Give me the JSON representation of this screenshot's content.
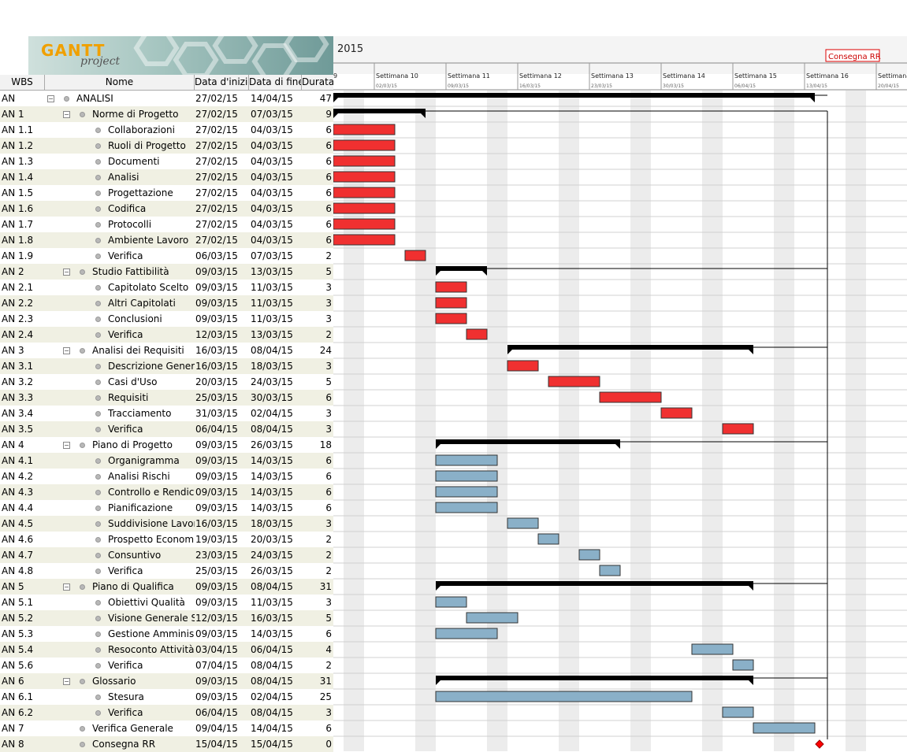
{
  "app": {
    "logo_main": "GANTT",
    "logo_sub": "project"
  },
  "columns": {
    "wbs": "WBS",
    "name": "Nome",
    "start": "Data d'inizio",
    "end": "Data di fine",
    "dur": "Durata"
  },
  "timeline": {
    "year": "2015",
    "milestone_label": "Consegna RR",
    "left_tick": "9",
    "weeks": [
      {
        "label": "Settimana 10",
        "date": "02/03/15"
      },
      {
        "label": "Settimana 11",
        "date": "09/03/15"
      },
      {
        "label": "Settimana 12",
        "date": "16/03/15"
      },
      {
        "label": "Settimana 13",
        "date": "23/03/15"
      },
      {
        "label": "Settimana 14",
        "date": "30/03/15"
      },
      {
        "label": "Settimana 15",
        "date": "06/04/15"
      },
      {
        "label": "Settimana 16",
        "date": "13/04/15"
      },
      {
        "label": "Settimana",
        "date": "20/04/15"
      }
    ]
  },
  "tasks": [
    {
      "wbs": "AN",
      "name": "ANALISI",
      "start": "27/02/15",
      "end": "14/04/15",
      "dur": "47",
      "level": 0,
      "group": true,
      "color": "#000000"
    },
    {
      "wbs": "AN 1",
      "name": "Norme di Progetto",
      "start": "27/02/15",
      "end": "07/03/15",
      "dur": "9",
      "level": 1,
      "group": true,
      "color": "#000000"
    },
    {
      "wbs": "AN 1.1",
      "name": "Collaborazioni",
      "start": "27/02/15",
      "end": "04/03/15",
      "dur": "6",
      "level": 2,
      "group": false,
      "color": "#f03030"
    },
    {
      "wbs": "AN 1.2",
      "name": "Ruoli di Progetto",
      "start": "27/02/15",
      "end": "04/03/15",
      "dur": "6",
      "level": 2,
      "group": false,
      "color": "#f03030"
    },
    {
      "wbs": "AN 1.3",
      "name": "Documenti",
      "start": "27/02/15",
      "end": "04/03/15",
      "dur": "6",
      "level": 2,
      "group": false,
      "color": "#f03030"
    },
    {
      "wbs": "AN 1.4",
      "name": "Analisi",
      "start": "27/02/15",
      "end": "04/03/15",
      "dur": "6",
      "level": 2,
      "group": false,
      "color": "#f03030"
    },
    {
      "wbs": "AN 1.5",
      "name": "Progettazione",
      "start": "27/02/15",
      "end": "04/03/15",
      "dur": "6",
      "level": 2,
      "group": false,
      "color": "#f03030"
    },
    {
      "wbs": "AN 1.6",
      "name": "Codifica",
      "start": "27/02/15",
      "end": "04/03/15",
      "dur": "6",
      "level": 2,
      "group": false,
      "color": "#f03030"
    },
    {
      "wbs": "AN 1.7",
      "name": "Protocolli",
      "start": "27/02/15",
      "end": "04/03/15",
      "dur": "6",
      "level": 2,
      "group": false,
      "color": "#f03030"
    },
    {
      "wbs": "AN 1.8",
      "name": "Ambiente Lavoro",
      "start": "27/02/15",
      "end": "04/03/15",
      "dur": "6",
      "level": 2,
      "group": false,
      "color": "#f03030"
    },
    {
      "wbs": "AN 1.9",
      "name": "Verifica",
      "start": "06/03/15",
      "end": "07/03/15",
      "dur": "2",
      "level": 2,
      "group": false,
      "color": "#f03030"
    },
    {
      "wbs": "AN 2",
      "name": "Studio Fattibilità",
      "start": "09/03/15",
      "end": "13/03/15",
      "dur": "5",
      "level": 1,
      "group": true,
      "color": "#000000"
    },
    {
      "wbs": "AN 2.1",
      "name": "Capitolato Scelto",
      "start": "09/03/15",
      "end": "11/03/15",
      "dur": "3",
      "level": 2,
      "group": false,
      "color": "#f03030"
    },
    {
      "wbs": "AN 2.2",
      "name": "Altri Capitolati",
      "start": "09/03/15",
      "end": "11/03/15",
      "dur": "3",
      "level": 2,
      "group": false,
      "color": "#f03030"
    },
    {
      "wbs": "AN 2.3",
      "name": "Conclusioni",
      "start": "09/03/15",
      "end": "11/03/15",
      "dur": "3",
      "level": 2,
      "group": false,
      "color": "#f03030"
    },
    {
      "wbs": "AN 2.4",
      "name": "Verifica",
      "start": "12/03/15",
      "end": "13/03/15",
      "dur": "2",
      "level": 2,
      "group": false,
      "color": "#f03030"
    },
    {
      "wbs": "AN 3",
      "name": "Analisi dei Requisiti",
      "start": "16/03/15",
      "end": "08/04/15",
      "dur": "24",
      "level": 1,
      "group": true,
      "color": "#000000"
    },
    {
      "wbs": "AN 3.1",
      "name": "Descrizione Generale",
      "start": "16/03/15",
      "end": "18/03/15",
      "dur": "3",
      "level": 2,
      "group": false,
      "color": "#f03030"
    },
    {
      "wbs": "AN 3.2",
      "name": "Casi d'Uso",
      "start": "20/03/15",
      "end": "24/03/15",
      "dur": "5",
      "level": 2,
      "group": false,
      "color": "#f03030"
    },
    {
      "wbs": "AN 3.3",
      "name": "Requisiti",
      "start": "25/03/15",
      "end": "30/03/15",
      "dur": "6",
      "level": 2,
      "group": false,
      "color": "#f03030"
    },
    {
      "wbs": "AN 3.4",
      "name": "Tracciamento",
      "start": "31/03/15",
      "end": "02/04/15",
      "dur": "3",
      "level": 2,
      "group": false,
      "color": "#f03030"
    },
    {
      "wbs": "AN 3.5",
      "name": "Verifica",
      "start": "06/04/15",
      "end": "08/04/15",
      "dur": "3",
      "level": 2,
      "group": false,
      "color": "#f03030"
    },
    {
      "wbs": "AN 4",
      "name": "Piano di Progetto",
      "start": "09/03/15",
      "end": "26/03/15",
      "dur": "18",
      "level": 1,
      "group": true,
      "color": "#000000"
    },
    {
      "wbs": "AN 4.1",
      "name": "Organigramma",
      "start": "09/03/15",
      "end": "14/03/15",
      "dur": "6",
      "level": 2,
      "group": false,
      "color": "#8ab0c8"
    },
    {
      "wbs": "AN 4.2",
      "name": "Analisi Rischi",
      "start": "09/03/15",
      "end": "14/03/15",
      "dur": "6",
      "level": 2,
      "group": false,
      "color": "#8ab0c8"
    },
    {
      "wbs": "AN 4.3",
      "name": "Controllo e Rendic...",
      "start": "09/03/15",
      "end": "14/03/15",
      "dur": "6",
      "level": 2,
      "group": false,
      "color": "#8ab0c8"
    },
    {
      "wbs": "AN 4.4",
      "name": "Pianificazione",
      "start": "09/03/15",
      "end": "14/03/15",
      "dur": "6",
      "level": 2,
      "group": false,
      "color": "#8ab0c8"
    },
    {
      "wbs": "AN 4.5",
      "name": "Suddivisione Lavoro",
      "start": "16/03/15",
      "end": "18/03/15",
      "dur": "3",
      "level": 2,
      "group": false,
      "color": "#8ab0c8"
    },
    {
      "wbs": "AN 4.6",
      "name": "Prospetto Econom...",
      "start": "19/03/15",
      "end": "20/03/15",
      "dur": "2",
      "level": 2,
      "group": false,
      "color": "#8ab0c8"
    },
    {
      "wbs": "AN 4.7",
      "name": "Consuntivo",
      "start": "23/03/15",
      "end": "24/03/15",
      "dur": "2",
      "level": 2,
      "group": false,
      "color": "#8ab0c8"
    },
    {
      "wbs": "AN 4.8",
      "name": "Verifica",
      "start": "25/03/15",
      "end": "26/03/15",
      "dur": "2",
      "level": 2,
      "group": false,
      "color": "#8ab0c8"
    },
    {
      "wbs": "AN 5",
      "name": "Piano di Qualifica",
      "start": "09/03/15",
      "end": "08/04/15",
      "dur": "31",
      "level": 1,
      "group": true,
      "color": "#000000"
    },
    {
      "wbs": "AN 5.1",
      "name": "Obiettivi Qualità",
      "start": "09/03/15",
      "end": "11/03/15",
      "dur": "3",
      "level": 2,
      "group": false,
      "color": "#8ab0c8"
    },
    {
      "wbs": "AN 5.2",
      "name": "Visione Generale St...",
      "start": "12/03/15",
      "end": "16/03/15",
      "dur": "5",
      "level": 2,
      "group": false,
      "color": "#8ab0c8"
    },
    {
      "wbs": "AN 5.3",
      "name": "Gestione Amminis...",
      "start": "09/03/15",
      "end": "14/03/15",
      "dur": "6",
      "level": 2,
      "group": false,
      "color": "#8ab0c8"
    },
    {
      "wbs": "AN 5.4",
      "name": "Resoconto Attività",
      "start": "03/04/15",
      "end": "06/04/15",
      "dur": "4",
      "level": 2,
      "group": false,
      "color": "#8ab0c8"
    },
    {
      "wbs": "AN 5.6",
      "name": "Verifica",
      "start": "07/04/15",
      "end": "08/04/15",
      "dur": "2",
      "level": 2,
      "group": false,
      "color": "#8ab0c8"
    },
    {
      "wbs": "AN 6",
      "name": "Glossario",
      "start": "09/03/15",
      "end": "08/04/15",
      "dur": "31",
      "level": 1,
      "group": true,
      "color": "#000000"
    },
    {
      "wbs": "AN 6.1",
      "name": "Stesura",
      "start": "09/03/15",
      "end": "02/04/15",
      "dur": "25",
      "level": 2,
      "group": false,
      "color": "#8ab0c8"
    },
    {
      "wbs": "AN 6.2",
      "name": "Verifica",
      "start": "06/04/15",
      "end": "08/04/15",
      "dur": "3",
      "level": 2,
      "group": false,
      "color": "#8ab0c8"
    },
    {
      "wbs": "AN 7",
      "name": "Verifica Generale",
      "start": "09/04/15",
      "end": "14/04/15",
      "dur": "6",
      "level": 1,
      "group": false,
      "color": "#8ab0c8"
    },
    {
      "wbs": "AN 8",
      "name": "Consegna RR",
      "start": "15/04/15",
      "end": "15/04/15",
      "dur": "0",
      "level": 1,
      "group": false,
      "milestone": true,
      "color": "#ff0000"
    }
  ]
}
